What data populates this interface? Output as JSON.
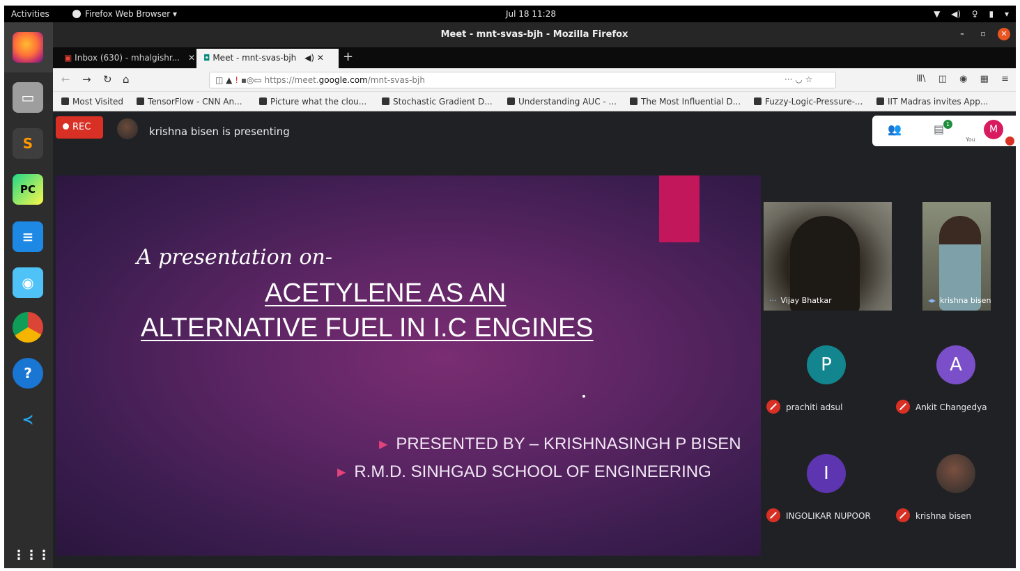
{
  "system": {
    "activities": "Activities",
    "app_menu": "Firefox Web Browser ▾",
    "clock": "Jul 18  11:28",
    "tray_icons": [
      "network-icon",
      "volume-icon",
      "mic-icon",
      "battery-icon",
      "system-menu-icon"
    ]
  },
  "window": {
    "title": "Meet - mnt-svas-bjh - Mozilla Firefox"
  },
  "tabs": [
    {
      "label": "Inbox (630) - mhalgishr...",
      "active": false
    },
    {
      "label": "Meet - mnt-svas-bjh",
      "active": true
    }
  ],
  "url": {
    "prefix": "https://meet.",
    "host": "google.com",
    "path": "/mnt-svas-bjh"
  },
  "bookmarks": [
    "Most Visited",
    "TensorFlow - CNN An...",
    "Picture what the clou...",
    "Stochastic Gradient D...",
    "Understanding AUC - ...",
    "The Most Influential D...",
    "Fuzzy-Logic-Pressure-...",
    "IIT Madras invites App..."
  ],
  "meet": {
    "rec_label": "REC",
    "presenting_text": "krishna bisen is presenting",
    "you_label": "You",
    "me_initial": "M",
    "chat_badge": "1",
    "colors": {
      "rec": "#d93025",
      "me_avatar": "#d81b60"
    }
  },
  "slide": {
    "subtitle": "A presentation on-",
    "title_line1": "ACETYLENE AS AN",
    "title_line2": "ALTERNATIVE FUEL IN I.C ENGINES",
    "bullets": [
      "PRESENTED BY – KRISHNASINGH P BISEN",
      "R.M.D. SINHGAD SCHOOL OF ENGINEERING"
    ]
  },
  "participants": {
    "video": [
      {
        "name": "Vijay Bhatkar"
      },
      {
        "name": "krishna bisen"
      }
    ],
    "tiles": [
      {
        "name": "prachiti adsul",
        "initial": "P",
        "color": "#12858f"
      },
      {
        "name": "Ankit Changedya",
        "initial": "A",
        "color": "#7b4fc9"
      },
      {
        "name": "INGOLIKAR NUPOOR",
        "initial": "I",
        "color": "#5e35b1"
      },
      {
        "name": "krishna bisen",
        "initial": ""
      }
    ]
  }
}
